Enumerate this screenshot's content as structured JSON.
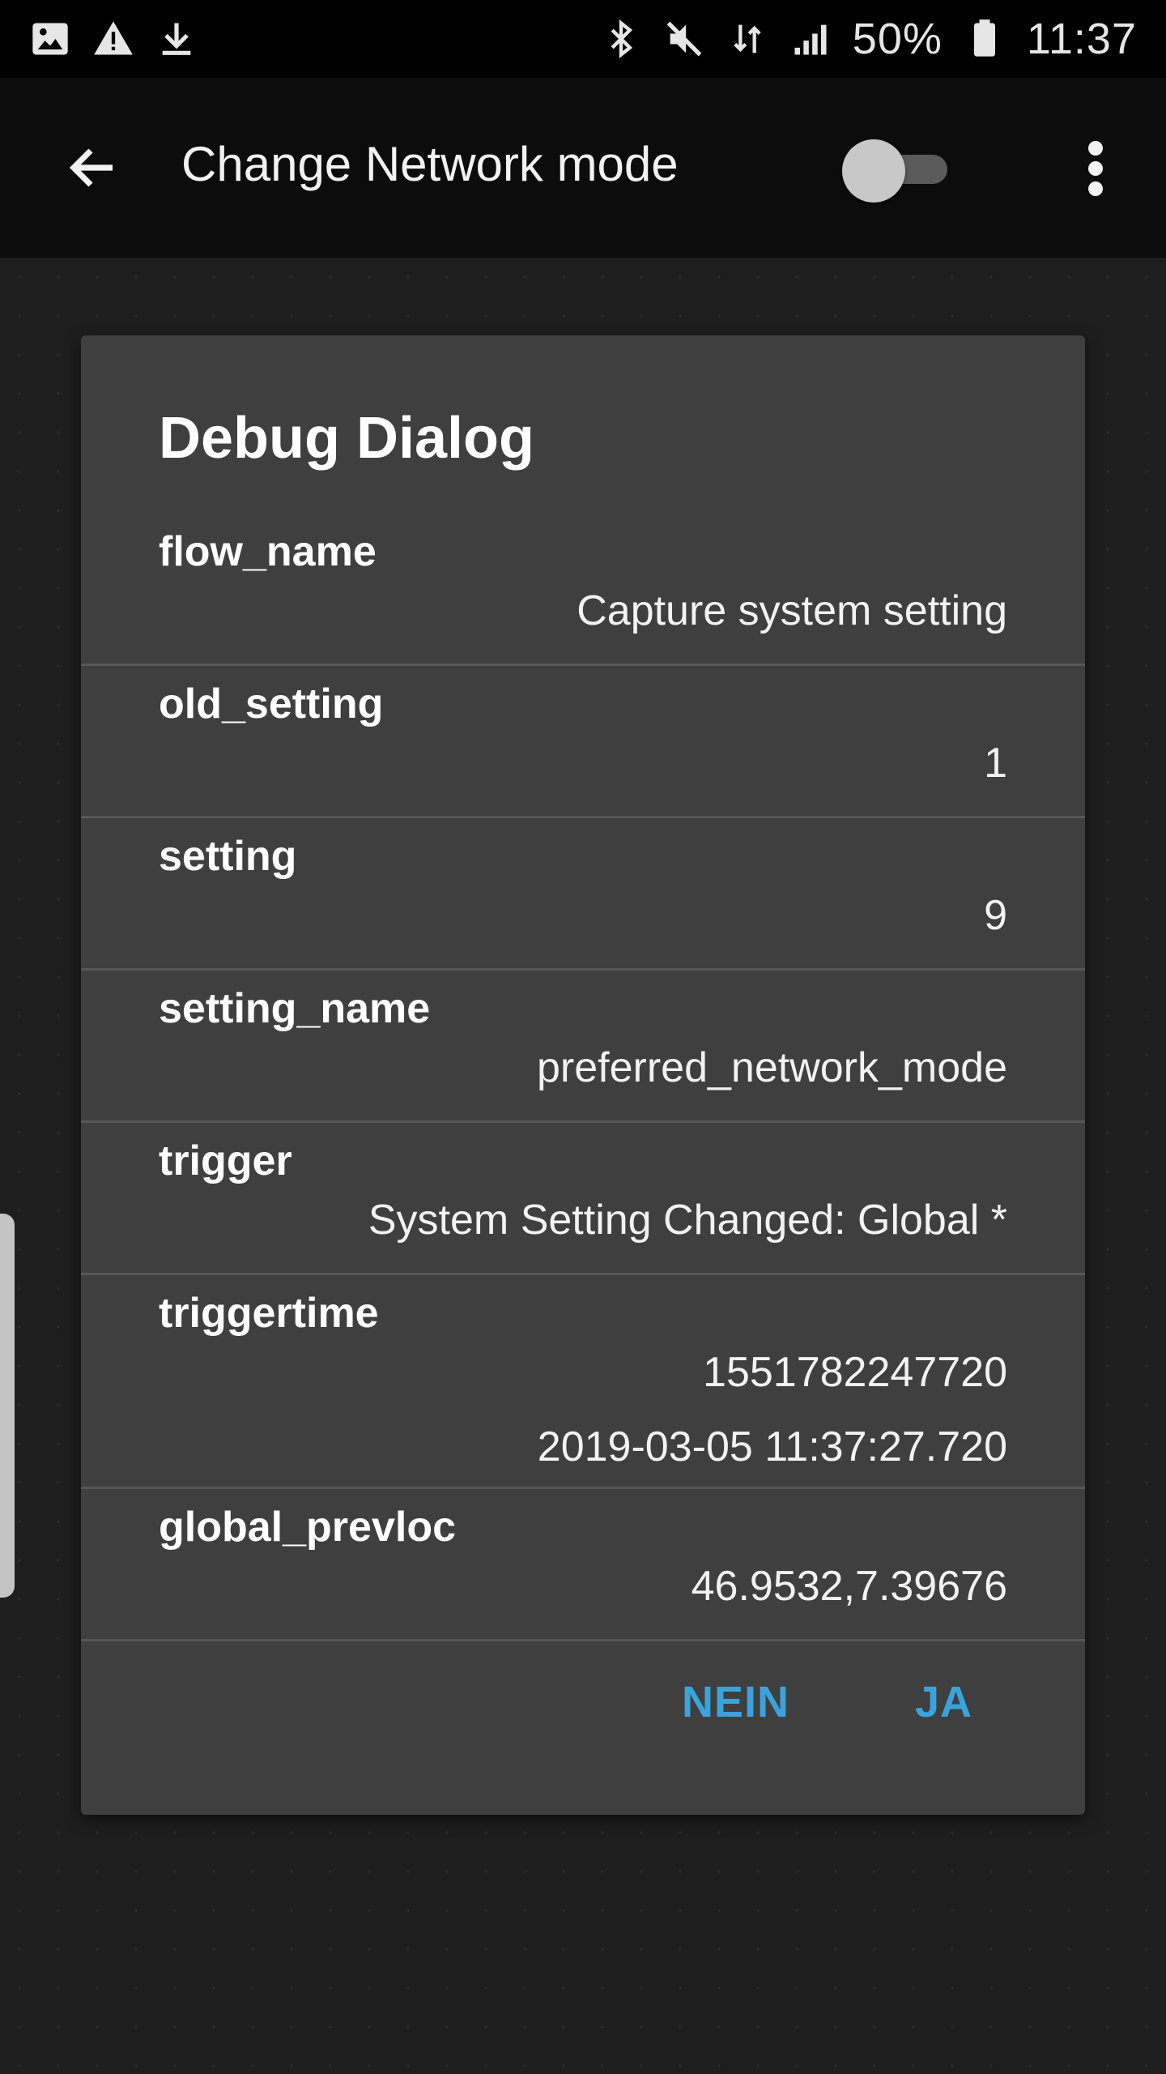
{
  "status_bar": {
    "left_icons": [
      "image-icon",
      "warning-icon",
      "download-icon"
    ],
    "right_icons": [
      "bluetooth-icon",
      "mute-icon",
      "data-arrows-icon",
      "signal-icon",
      "battery-icon"
    ],
    "battery_percent": "50%",
    "time": "11:37"
  },
  "app_bar": {
    "title": "Change Network mode",
    "toggle_on": false
  },
  "dialog": {
    "title": "Debug Dialog",
    "rows": [
      {
        "key": "flow_name",
        "value": "Capture system setting"
      },
      {
        "key": "old_setting",
        "value": "1"
      },
      {
        "key": "setting",
        "value": "9"
      },
      {
        "key": "setting_name",
        "value": "preferred_network_mode"
      },
      {
        "key": "trigger",
        "value": "System Setting Changed: Global *"
      },
      {
        "key": "triggertime",
        "value": "1551782247720",
        "value2": "2019-03-05 11:37:27.720"
      },
      {
        "key": "global_prevloc",
        "value": "46.9532,7.39676"
      }
    ],
    "buttons": {
      "negative": "NEIN",
      "positive": "JA"
    }
  },
  "colors": {
    "accent": "#3ba3dc",
    "dialog_bg": "#3f3f3f",
    "background": "#1e1e1e"
  }
}
